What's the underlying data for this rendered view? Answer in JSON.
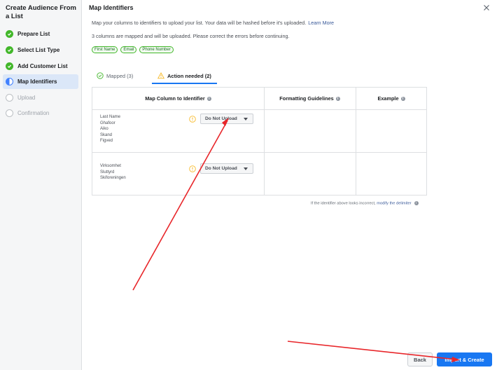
{
  "sidebar": {
    "title": "Create Audience From a List",
    "steps": [
      {
        "label": "Prepare List",
        "state": "done"
      },
      {
        "label": "Select List Type",
        "state": "done"
      },
      {
        "label": "Add Customer List",
        "state": "done"
      },
      {
        "label": "Map Identifiers",
        "state": "active"
      },
      {
        "label": "Upload",
        "state": "pending"
      },
      {
        "label": "Confirmation",
        "state": "pending"
      }
    ]
  },
  "main": {
    "title": "Map Identifiers",
    "intro": "Map your columns to identifiers to upload your list. Your data will be hashed before it's uploaded.",
    "learn_more": "Learn More",
    "mapped_text": "3 columns are mapped and will be uploaded. Please correct the errors before continuing.",
    "tags": [
      "First Name",
      "Email",
      "Phone Number"
    ],
    "tabs": {
      "mapped": "Mapped (3)",
      "action_needed": "Action needed (2)"
    },
    "table": {
      "headers": [
        "Map Column to Identifier",
        "Formatting Guidelines",
        "Example"
      ],
      "rows": [
        {
          "values": [
            "Last Name",
            "Ghafoor",
            "Aiko",
            "Skand",
            "Figved"
          ],
          "dropdown": "Do Not Upload"
        },
        {
          "values": [
            "Virksomhet",
            "Sluttyrd",
            "Skiforeningen"
          ],
          "dropdown": "Do Not Upload"
        }
      ]
    },
    "footnote": {
      "text": "If the identifier above looks incorrect,",
      "link": "modify the delimiter"
    }
  },
  "footer": {
    "back": "Back",
    "import": "Import & Create"
  },
  "colors": {
    "accent": "#1877f2",
    "success": "#42b72a",
    "warning": "#f7b928",
    "annotation_arrow": "#e8262a"
  }
}
